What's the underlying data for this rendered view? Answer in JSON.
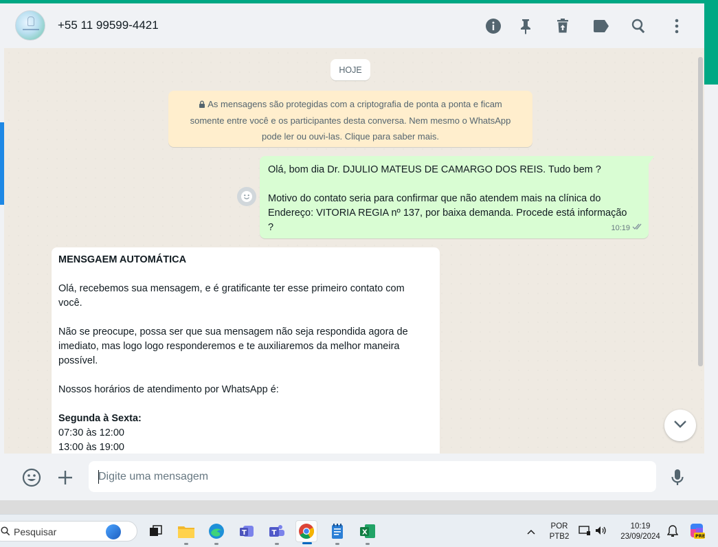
{
  "header": {
    "contact_name": "+55 11 99599-4421",
    "icons": [
      "info-icon",
      "pin-icon",
      "delete-icon",
      "label-icon",
      "search-icon",
      "menu-icon"
    ]
  },
  "chat": {
    "date_label": "HOJE",
    "encryption_notice": {
      "line1": "As mensagens são protegidas com a criptografia de ponta a ponta e ficam",
      "line2": "somente entre você e os participantes desta conversa. Nem mesmo o WhatsApp",
      "line3": "pode ler ou ouvi-las. Clique para saber mais."
    },
    "outgoing": {
      "line1": "Olá, bom dia Dr.  DJULIO MATEUS DE CAMARGO DOS REIS. Tudo bem ?",
      "line2": "Motivo do contato seria para confirmar que não atendem mais na clínica do",
      "line3": "Endereço: VITORIA REGIA nº 137, por baixa demanda. Procede está informação",
      "line4": "?",
      "time": "10:19"
    },
    "incoming": {
      "title": "MENSGAEM AUTOMÁTICA",
      "p1_line1": "Olá, recebemos sua mensagem, e é gratificante ter esse primeiro contato com",
      "p1_line2": "você.",
      "p2_line1": "Não se preocupe, possa ser que sua mensagem não seja respondida agora de",
      "p2_line2": "imediato, mas logo logo responderemos e te auxiliaremos da melhor maneira",
      "p2_line3": "possível.",
      "p3": "Nossos horários de atendimento por WhatsApp é:",
      "schedule_heading": "Segunda à Sexta:",
      "slot1": "07:30 às 12:00",
      "slot2": "13:00 às 19:00"
    }
  },
  "composer": {
    "placeholder": "Digite uma mensagem"
  },
  "taskbar": {
    "search_label": "Pesquisar",
    "language_line1": "POR",
    "language_line2": "PTB2",
    "clock_time": "10:19",
    "clock_date": "23/09/2024",
    "copilot_badge": "PRE"
  },
  "colors": {
    "accent": "#00a884",
    "outgoing_bubble": "#d9fdd3",
    "notice_bg": "#ffeecd"
  }
}
